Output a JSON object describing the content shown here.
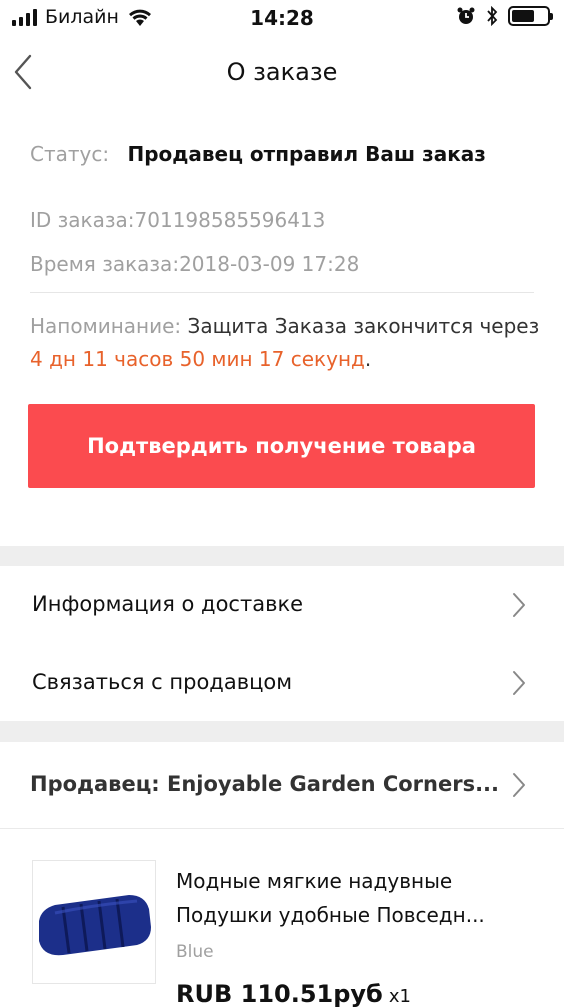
{
  "status_bar": {
    "carrier": "Билайн",
    "time": "14:28"
  },
  "nav": {
    "title": "О заказе"
  },
  "order": {
    "status_label": "Статус:",
    "status_value": "Продавец отправил Ваш заказ",
    "id_label": "ID заказа:",
    "id_value": "701198585596413",
    "time_label": "Время заказа:",
    "time_value": "2018-03-09 17:28",
    "reminder_label": "Напоминание:",
    "reminder_text": " Защита Заказа закончится через ",
    "reminder_countdown": "4 дн 11 часов 50 мин 17 секунд",
    "reminder_end": ".",
    "confirm_button": "Подтвердить получение товара"
  },
  "menu": {
    "delivery_info": "Информация о доставке",
    "contact_seller": "Связаться с продавцом"
  },
  "seller": {
    "label": "Продавец: Enjoyable Garden Corners..."
  },
  "product": {
    "name_line1": "Модные мягкие надувные",
    "name_line2": "Подушки удобные Повседн...",
    "variant": "Blue",
    "price": "RUB 110.51руб",
    "quantity": "x1"
  },
  "colors": {
    "accent_red": "#fb4b4f",
    "countdown_orange": "#e8622b"
  },
  "icons": {
    "back": "chevron-left-icon",
    "row_arrow": "chevron-right-icon",
    "signal": "signal-icon",
    "wifi": "wifi-icon",
    "alarm": "alarm-icon",
    "bluetooth": "bluetooth-icon",
    "battery": "battery-icon"
  }
}
